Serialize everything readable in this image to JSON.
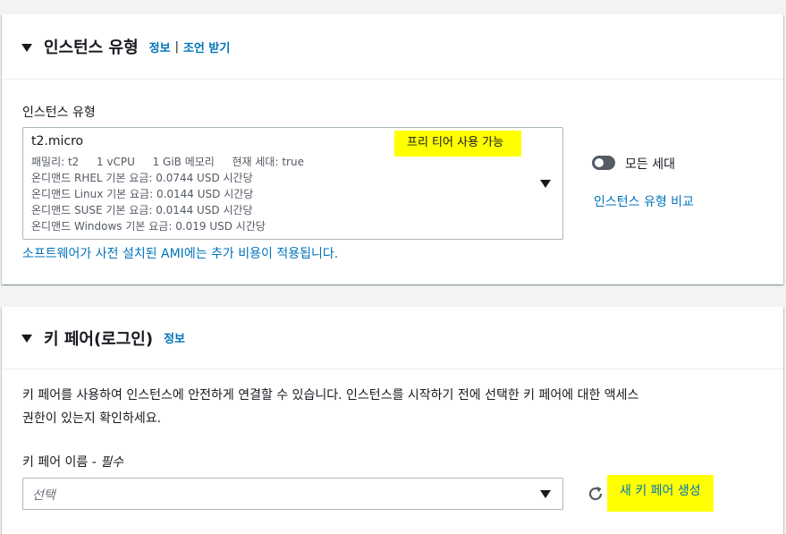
{
  "instance_panel": {
    "title": "인스턴스 유형",
    "info_link": "정보",
    "separator": "|",
    "advice_link": "조언 받기",
    "field_label": "인스턴스 유형",
    "selected": {
      "name": "t2.micro",
      "badge": "프리 티어 사용 가능",
      "family": "패밀리: t2",
      "vcpu": "1 vCPU",
      "memory": "1 GiB 메모리",
      "generation": "현재 세대: true",
      "pricing": [
        "온디맨드 RHEL 기본 요금: 0.0744 USD 시간당",
        "온디맨드 Linux 기본 요금: 0.0144 USD 시간당",
        "온디맨드 SUSE 기본 요금: 0.0144 USD 시간당",
        "온디맨드 Windows 기본 요금: 0.019 USD 시간당"
      ]
    },
    "all_generations_label": "모든 세대",
    "all_generations_on": false,
    "compare_link": "인스턴스 유형 비교",
    "ami_note": "소프트웨어가 사전 설치된 AMI에는 추가 비용이 적용됩니다."
  },
  "keypair_panel": {
    "title": "키 페어(로그인)",
    "info_link": "정보",
    "description_line1": "키 페어를 사용하여 인스턴스에 안전하게 연결할 수 있습니다. 인스턴스를 시작하기 전에 선택한 키 페어에 대한 액세스",
    "description_line2": "권한이 있는지 확인하세요.",
    "field_label": "키 페어 이름 - ",
    "required_label": "필수",
    "select_placeholder": "선택",
    "refresh_icon": "refresh-icon",
    "create_button": "새 키 페어 생성"
  },
  "colors": {
    "link": "#0073bb",
    "highlight": "#ffff00",
    "background": "#f2f3f3"
  }
}
